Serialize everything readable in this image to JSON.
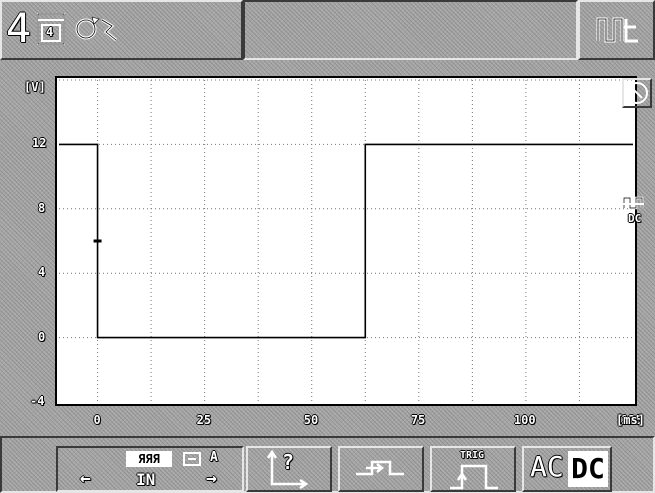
{
  "header": {
    "channel_number": "4",
    "page_icon_digit": "4",
    "page_icon": "memory-page-icon",
    "signal_icon": "rotating-signal-icon",
    "coupling_icon": "waveform-coupling-icon"
  },
  "plot": {
    "y_unit": "[V]",
    "x_unit": "[ms]",
    "y_ticks": [
      "12",
      "8",
      "4",
      "0",
      "-4"
    ],
    "x_ticks": [
      "0",
      "25",
      "50",
      "75",
      "100",
      "125"
    ],
    "side_label_top": "DC",
    "zoom_icon": "magnifier-icon"
  },
  "chart_data": {
    "type": "line",
    "title": "",
    "xlabel": "[ms]",
    "ylabel": "[V]",
    "xlim": [
      -9,
      125
    ],
    "ylim": [
      -4,
      16
    ],
    "grid": true,
    "series": [
      {
        "x": [
          -9,
          0,
          0,
          62.5,
          62.5,
          125
        ],
        "y": [
          12,
          12,
          0,
          0,
          12,
          12
        ]
      }
    ],
    "markers": [
      {
        "x": 0,
        "y": 6
      }
    ]
  },
  "softkeys": {
    "input_top_left": "ЯЯЯ",
    "input_top_right": "A",
    "input_label": "IN",
    "input_left_arrow": "←",
    "input_right_arrow": "→",
    "help_label": "?",
    "trig_label": "TRIG",
    "ac_label": "AC",
    "dc_label": "DC"
  },
  "colors": {
    "background": "#a6a6a6",
    "plot_background": "#ffffff",
    "trace": "#000000",
    "text": "#ffffff"
  }
}
